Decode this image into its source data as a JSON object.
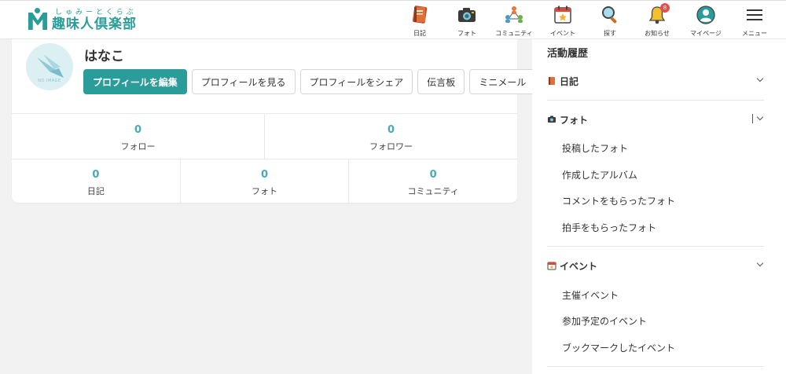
{
  "logo": {
    "sub": "しゅみーとくらぶ",
    "main": "趣味人倶楽部"
  },
  "nav": [
    {
      "key": "diary",
      "label": "日記",
      "icon": "diary-book-icon"
    },
    {
      "key": "photo",
      "label": "フォト",
      "icon": "camera-icon"
    },
    {
      "key": "community",
      "label": "コミュニティ",
      "icon": "community-people-icon"
    },
    {
      "key": "event",
      "label": "イベント",
      "icon": "calendar-star-icon"
    },
    {
      "key": "search",
      "label": "探す",
      "icon": "magnifier-icon"
    },
    {
      "key": "notice",
      "label": "お知らせ",
      "icon": "bell-icon",
      "badge": "8"
    },
    {
      "key": "mypage",
      "label": "マイページ",
      "icon": "user-avatar-icon"
    },
    {
      "key": "menu",
      "label": "メニュー",
      "icon": "hamburger-menu-icon"
    }
  ],
  "profile": {
    "avatar_text": "NO IMAGE",
    "name": "はなこ",
    "buttons": {
      "edit": "プロフィールを編集",
      "view": "プロフィールを見る",
      "share": "プロフィールをシェア",
      "board": "伝言板",
      "mail": "ミニメール"
    },
    "stats_top": [
      {
        "value": "0",
        "label": "フォロー"
      },
      {
        "value": "0",
        "label": "フォロワー"
      }
    ],
    "stats_bottom": [
      {
        "value": "0",
        "label": "日記"
      },
      {
        "value": "0",
        "label": "フォト"
      },
      {
        "value": "0",
        "label": "コミュニティ"
      }
    ]
  },
  "sidebar": {
    "title": "活動履歴",
    "sections": {
      "diary": {
        "label": "日記",
        "icon": "diary-book-icon"
      },
      "photo": {
        "label": "フォト",
        "icon": "camera-icon",
        "items": [
          "投稿したフォト",
          "作成したアルバム",
          "コメントをもらったフォト",
          "拍手をもらったフォト"
        ]
      },
      "event": {
        "label": "イベント",
        "icon": "calendar-icon",
        "items": [
          "主催イベント",
          "参加予定のイベント",
          "ブックマークしたイベント"
        ]
      }
    }
  },
  "colors": {
    "brand": "#2a9d9a",
    "stat_value": "#4aa8b8",
    "badge": "#e05050"
  }
}
